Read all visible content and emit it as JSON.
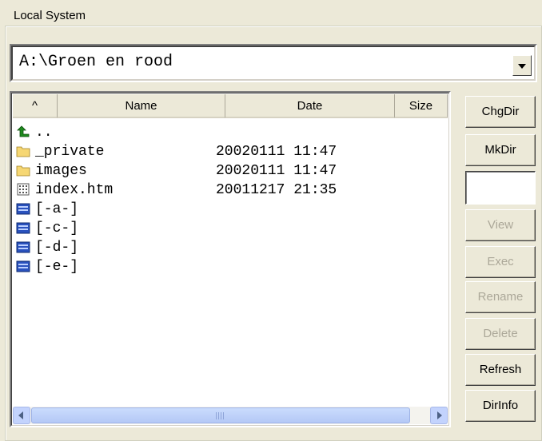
{
  "panel": {
    "title": "Local System"
  },
  "path": {
    "value": "A:\\Groen en rood"
  },
  "list": {
    "columns": {
      "sort": "^",
      "name": "Name",
      "date": "Date",
      "size": "Size"
    },
    "rows": [
      {
        "icon": "up-folder-icon",
        "name": "..",
        "date": "",
        "size": ""
      },
      {
        "icon": "folder-icon",
        "name": "_private",
        "date": "20020111 11:47",
        "size": ""
      },
      {
        "icon": "folder-icon",
        "name": "images",
        "date": "20020111 11:47",
        "size": ""
      },
      {
        "icon": "html-file-icon",
        "name": "index.htm",
        "date": "20011217 21:35",
        "size": ""
      },
      {
        "icon": "drive-icon",
        "name": "[-a-]",
        "date": "",
        "size": ""
      },
      {
        "icon": "drive-icon",
        "name": "[-c-]",
        "date": "",
        "size": ""
      },
      {
        "icon": "drive-icon",
        "name": "[-d-]",
        "date": "",
        "size": ""
      },
      {
        "icon": "drive-icon",
        "name": "[-e-]",
        "date": "",
        "size": ""
      }
    ]
  },
  "buttons": {
    "chgdir": "ChgDir",
    "mkdir": "MkDir",
    "view": "View",
    "exec": "Exec",
    "rename": "Rename",
    "delete": "Delete",
    "refresh": "Refresh",
    "dirinfo": "DirInfo"
  },
  "colors": {
    "folder": "#f6d774",
    "up_arrow": "#1e8a1e",
    "drive": "#2a52be",
    "disabled_text": "#aca899"
  }
}
